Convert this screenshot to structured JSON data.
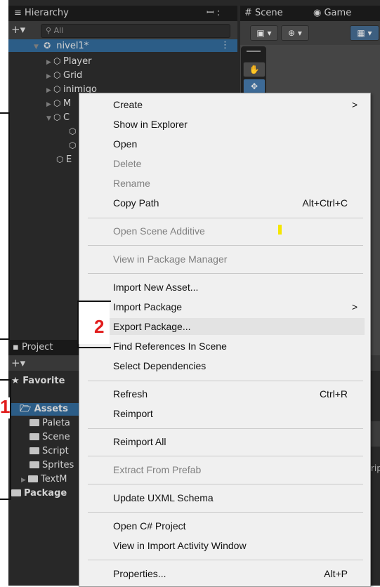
{
  "hierarchy": {
    "tab_label": "≡ Hierarchy",
    "tab_icons": "ꟷ :",
    "search_placeholder": "All",
    "add_label": "+▾",
    "root": "nivel1*",
    "items": [
      "Player",
      "Grid",
      "inimigo",
      "M",
      "C",
      "",
      "",
      "E"
    ]
  },
  "scene": {
    "tab_scene": "# Scene",
    "tab_game": "Game"
  },
  "project": {
    "tab_label": "Project",
    "add_label": "+▾",
    "favorites": "Favorite",
    "assets": "Assets",
    "folders": [
      "Paleta",
      "Scene",
      "Script",
      "Sprites",
      "TextM"
    ],
    "packages": "Package",
    "right_text": "ript"
  },
  "annotations": {
    "one": "1",
    "two": "2"
  },
  "context_menu": {
    "items": [
      {
        "label": "Create",
        "submenu": ">"
      },
      {
        "label": "Show in Explorer"
      },
      {
        "label": "Open"
      },
      {
        "label": "Delete",
        "disabled": true
      },
      {
        "label": "Rename",
        "disabled": true
      },
      {
        "label": "Copy Path",
        "shortcut": "Alt+Ctrl+C"
      },
      {
        "label": "Open Scene Additive",
        "disabled": true
      },
      {
        "label": "View in Package Manager",
        "disabled": true
      },
      {
        "label": "Import New Asset..."
      },
      {
        "label": "Import Package",
        "submenu": ">"
      },
      {
        "label": "Export Package...",
        "highlighted": true
      },
      {
        "label": "Find References In Scene"
      },
      {
        "label": "Select Dependencies"
      },
      {
        "label": "Refresh",
        "shortcut": "Ctrl+R"
      },
      {
        "label": "Reimport"
      },
      {
        "label": "Reimport All"
      },
      {
        "label": "Extract From Prefab",
        "disabled": true
      },
      {
        "label": "Update UXML Schema"
      },
      {
        "label": "Open C# Project"
      },
      {
        "label": "View in Import Activity Window"
      },
      {
        "label": "Properties...",
        "shortcut": "Alt+P"
      }
    ]
  },
  "colors": {
    "editor_bg": "#282828",
    "selection_blue": "#2c5d87",
    "menu_bg": "#f0f0f0",
    "annotation_red": "#e11b1b",
    "highlight_marker": "#f5e600"
  }
}
